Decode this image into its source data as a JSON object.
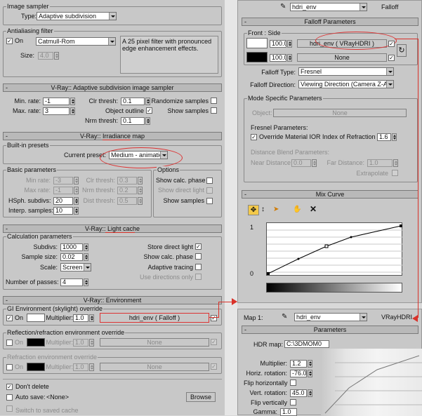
{
  "image_sampler": {
    "title": "Image sampler",
    "type_label": "Type:",
    "type_value": "Adaptive subdivision",
    "aa_title": "Antialiasing filter",
    "on_label": "On",
    "filter_value": "Catmull-Rom",
    "filter_desc": "A 25 pixel filter with pronounced edge enhancement effects.",
    "size_label": "Size:",
    "size_value": "4.0"
  },
  "adaptive": {
    "title": "V-Ray:: Adaptive subdivision image sampler",
    "min_rate_label": "Min. rate:",
    "min_rate": "-1",
    "max_rate_label": "Max. rate:",
    "max_rate": "3",
    "clr_thresh_label": "Clr thresh:",
    "clr_thresh": "0.1",
    "object_outline_label": "Object outline",
    "nrm_thresh_label": "Nrm thresh:",
    "nrm_thresh": "0.1",
    "randomize_label": "Randomize samples",
    "show_samples_label": "Show samples"
  },
  "irradiance": {
    "title_prefix": "V-Ray::",
    "title_main": "Irradiance map",
    "presets_title": "Built-in presets",
    "current_preset_label": "Current preset:",
    "current_preset": "Medium - animation",
    "basic_title": "Basic parameters",
    "min_rate_label": "Min rate:",
    "min_rate": "-3",
    "max_rate_label": "Max rate:",
    "max_rate": "-1",
    "hsph_label": "HSph. subdivs:",
    "hsph": "20",
    "interp_label": "Interp. samples:",
    "interp": "10",
    "clr_thresh_label": "Clr thresh:",
    "clr_thresh": "0.3",
    "nrm_thresh_label": "Nrm thresh:",
    "nrm_thresh": "0.2",
    "dist_thresh_label": "Dist thresh:",
    "dist_thresh": "0.5",
    "options_title": "Options",
    "show_calc_label": "Show calc. phase",
    "show_direct_label": "Show direct light",
    "show_samples_label": "Show samples"
  },
  "light_cache": {
    "title_prefix": "V-Ray::",
    "title_main": "Light cache",
    "calc_title": "Calculation parameters",
    "subdivs_label": "Subdivs:",
    "subdivs": "1000",
    "sample_size_label": "Sample size:",
    "sample_size": "0.02",
    "scale_label": "Scale:",
    "scale": "Screen",
    "passes_label": "Number of passes:",
    "passes": "4",
    "store_direct_label": "Store direct light",
    "show_calc_label": "Show calc. phase",
    "adaptive_label": "Adaptive tracing",
    "use_dirs_label": "Use directions only"
  },
  "environment": {
    "title": "V-Ray:: Environment",
    "gi_title": "GI Environment (skylight) override",
    "on_label": "On",
    "multiplier_label": "Multiplier:",
    "gi_multiplier": "1.0",
    "gi_map": "hdri_env  ( Falloff )",
    "refl_title": "Reflection/refraction environment override",
    "refl_multiplier": "1.0",
    "refl_map": "None",
    "refr_title": "Refraction environment override",
    "refr_multiplier": "1.0",
    "refr_map": "None"
  },
  "bottom": {
    "dont_delete_label": "Don't delete",
    "auto_save_label": "Auto save:",
    "auto_save_value": "<None>",
    "browse_label": "Browse",
    "switch_label": "Switch to saved cache"
  },
  "falloff": {
    "map_name": "hdri_env",
    "map_type": "Falloff",
    "params_title": "Falloff Parameters",
    "front_side_label": "Front : Side",
    "front_amount": "100.0",
    "front_map": "hdri_env  ( VRayHDRI )",
    "side_amount": "100.0",
    "side_map": "None",
    "type_label": "Falloff Type:",
    "type_value": "Fresnel",
    "direction_label": "Falloff Direction:",
    "direction_value": "Viewing Direction (Camera Z-Axis)",
    "mode_title": "Mode Specific Parameters",
    "object_label": "Object:",
    "object_value": "None",
    "fresnel_title": "Fresnel Parameters:",
    "override_ior_label": "Override Material IOR",
    "ior_label": "Index of Refraction",
    "ior_value": "1.6",
    "distance_title": "Distance Blend Parameters:",
    "near_label": "Near Distance:",
    "near_value": "0.0",
    "far_label": "Far Distance:",
    "far_value": "1.0",
    "extrapolate_label": "Extrapolate",
    "mix_curve_title": "Mix Curve",
    "curve_y_top": "1",
    "curve_y_bottom": "0"
  },
  "vrayhdri": {
    "map_label": "Map 1:",
    "map_name": "hdri_env",
    "map_type": "VRayHDRI",
    "params_title": "Parameters",
    "hdr_map_label": "HDR map:",
    "hdr_map_value": "C:\\3DMOM0",
    "multiplier_label": "Multiplier:",
    "multiplier": "1.2",
    "horiz_label": "Horiz. rotation:",
    "horiz": "-76.0",
    "flip_h_label": "Flip horizontally",
    "vert_label": "Vert. rotation:",
    "vert": "45.0",
    "flip_v_label": "Flip vertically",
    "gamma_label": "Gamma:",
    "gamma": "1.0"
  }
}
